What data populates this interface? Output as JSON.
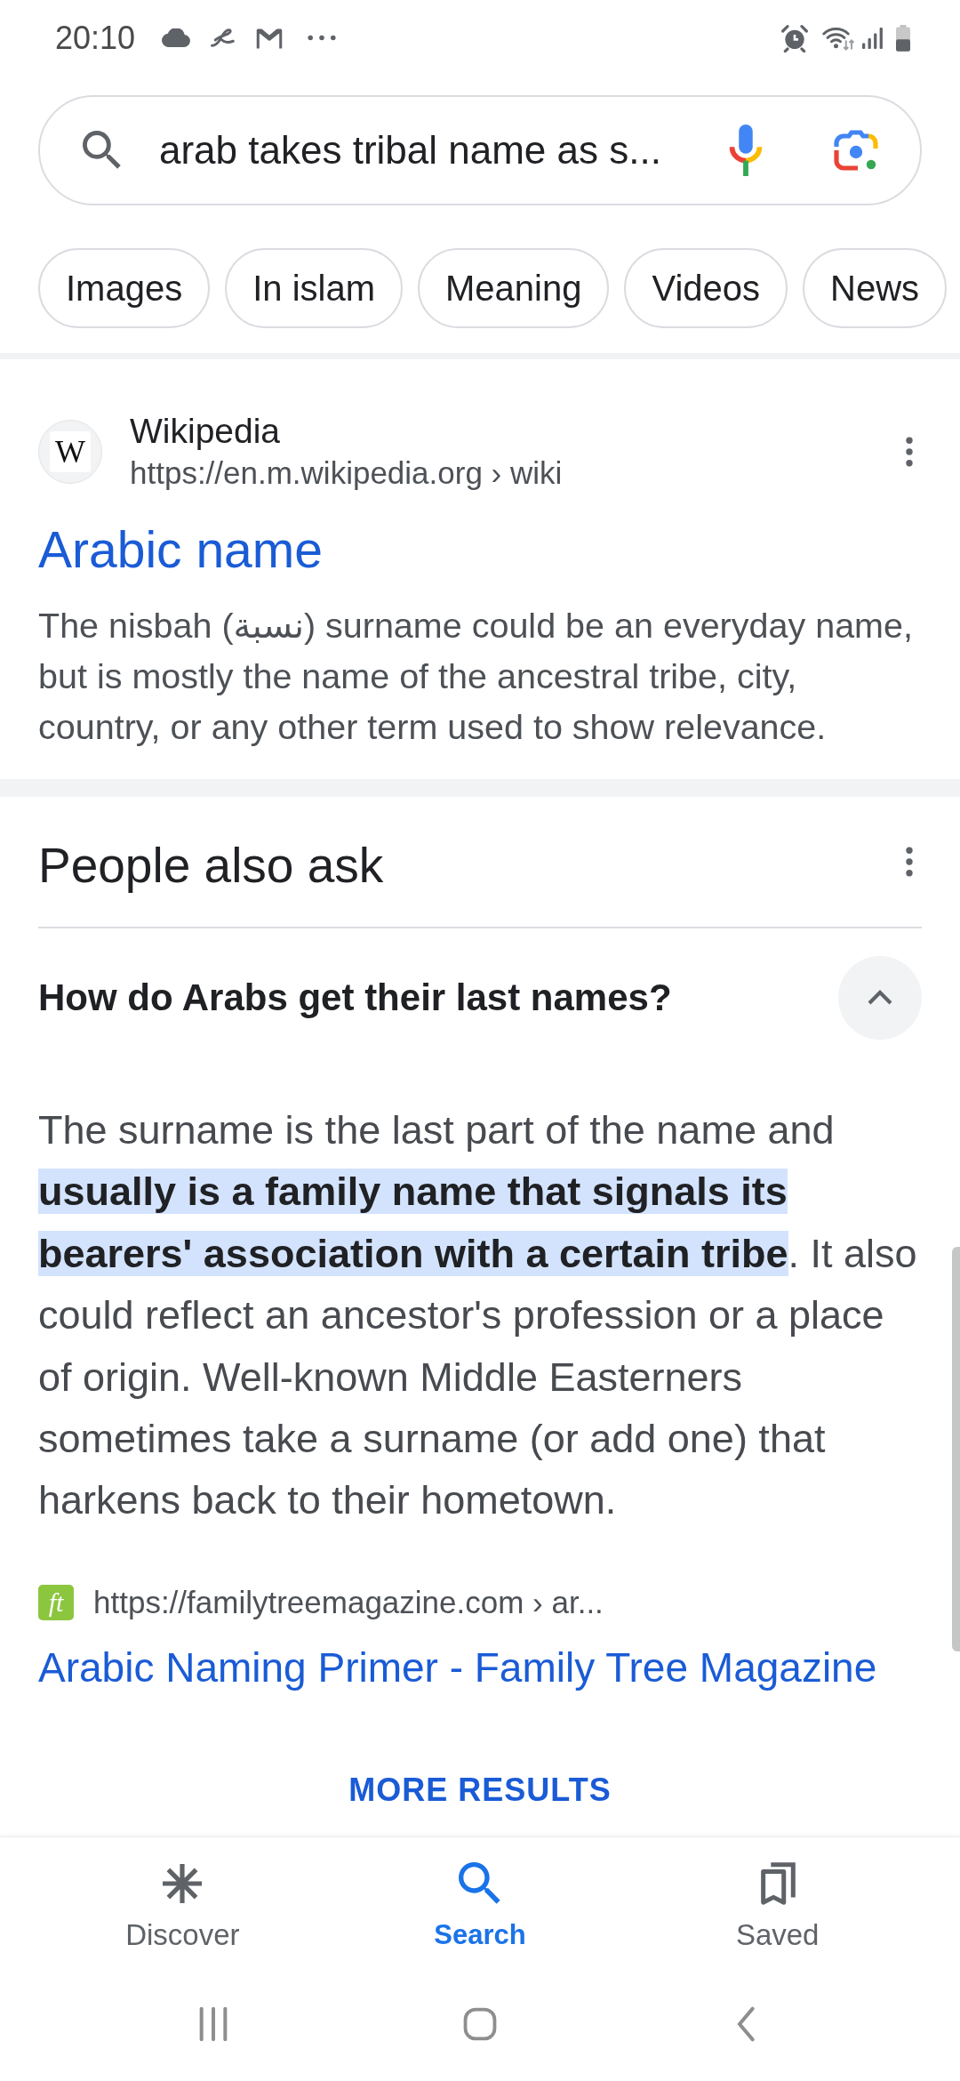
{
  "status_bar": {
    "time": "20:10"
  },
  "search": {
    "query": "arab takes tribal name as s..."
  },
  "chips": [
    "Images",
    "In islam",
    "Meaning",
    "Videos",
    "News"
  ],
  "results": [
    {
      "favicon_text": "W",
      "site": "Wikipedia",
      "url": "https://en.m.wikipedia.org › wiki",
      "title": "Arabic name",
      "snippet": "The nisbah (نسبة) surname could be an everyday name, but is mostly the name of the ancestral tribe, city, country, or any other term used to show relevance."
    }
  ],
  "people_also_ask": {
    "heading": "People also ask",
    "questions": [
      {
        "question": "How do Arabs get their last names?",
        "expanded": true,
        "answer": "The surname is the last part of the name and **usually is a family name that signals its bearers' association with a certain tribe**. It also could reflect an ancestor's profession or a place of origin. Well-known Middle Easterners sometimes take a surname (or add one) that harkens back to their hometown.",
        "source": {
          "favicon_text": "ft",
          "url": "https://familytreemagazine.com › ar...",
          "title": "Arabic Naming Primer - Family Tree Magazine"
        }
      }
    ],
    "more_button": "MORE RESULTS"
  },
  "bottom_nav": [
    {
      "label": "Discover",
      "selected": false
    },
    {
      "label": "Search",
      "selected": true
    },
    {
      "label": "Saved",
      "selected": false
    }
  ]
}
